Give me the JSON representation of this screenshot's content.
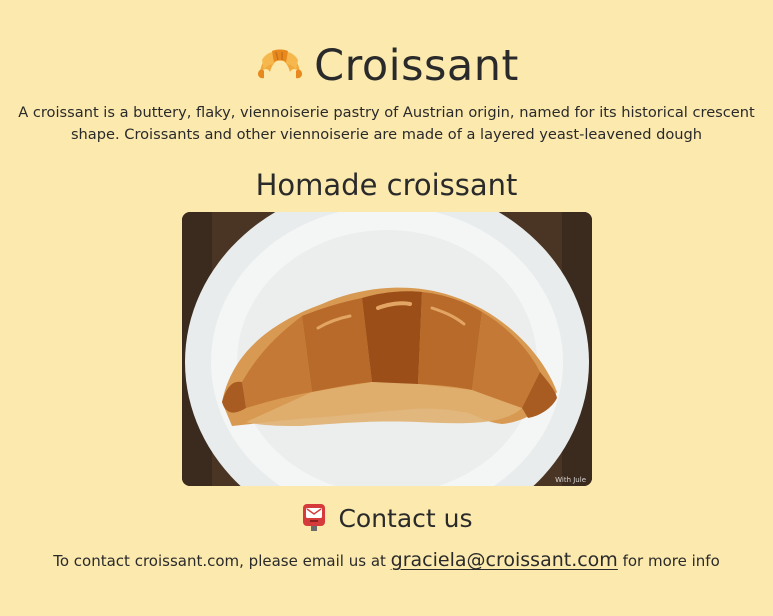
{
  "header": {
    "emoji_icon": "croissant-emoji",
    "title": "Croissant",
    "description": "A croissant is a buttery, flaky, viennoiserie pastry of Austrian origin, named for its historical crescent shape. Croissants and other viennoiserie are made of a layered yeast-leavened dough"
  },
  "photo_section": {
    "heading": "Homade croissant",
    "image_alt": "Croissant on a white plate",
    "watermark": "With Jule"
  },
  "contact": {
    "emoji_icon": "postbox-emoji",
    "heading": "Contact us",
    "text_before": "To contact croissant.com, please email us at ",
    "email": "graciela@croissant.com",
    "email_href": "mailto:graciela@croissant.com",
    "text_after": " for more info"
  },
  "colors": {
    "background": "#FBE9AE",
    "text": "#2a2a2a"
  }
}
